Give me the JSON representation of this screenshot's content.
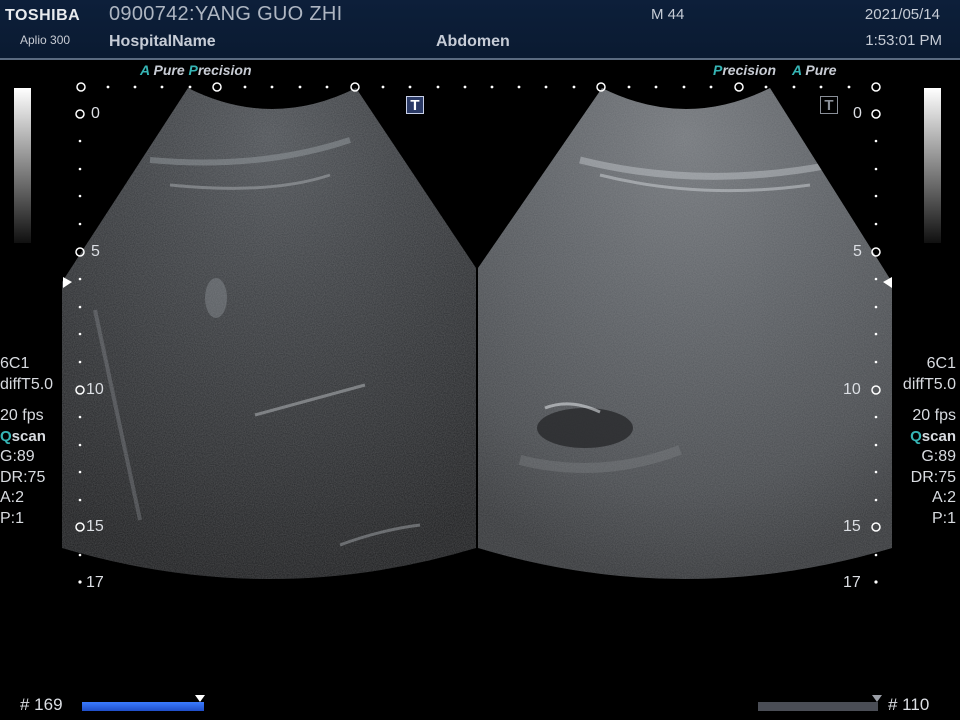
{
  "header": {
    "brand": "TOSHIBA",
    "model": "Aplio 300",
    "patient": "0900742:YANG GUO ZHI",
    "hospital": "HospitalName",
    "region": "Abdomen",
    "sex_age": "M 44",
    "date": "2021/05/14",
    "time": "1:53:01 PM"
  },
  "left_pane": {
    "mode_a": "A",
    "mode_pure": "Pure ",
    "mode_p": "P",
    "mode_precision": "recision",
    "t_label": "T",
    "t_state": "active",
    "depths": [
      "0",
      "5",
      "10",
      "15",
      "17"
    ],
    "params": {
      "probe": "6C1",
      "preset": "diffT5.0",
      "fps": "20 fps",
      "qscan_q": "Q",
      "qscan_rest": "scan",
      "gain": "G:89",
      "dr": "DR:75",
      "a": "A:2",
      "p": "P:1"
    },
    "frame": "# 169",
    "cine_fraction": 1.0
  },
  "right_pane": {
    "mode_p": "P",
    "mode_precision": "recision",
    "mode_a": "A",
    "mode_pure": "Pure",
    "t_label": "T",
    "t_state": "inactive",
    "depths": [
      "0",
      "5",
      "10",
      "15",
      "17"
    ],
    "params": {
      "probe": "6C1",
      "preset": "diffT5.0",
      "fps": "20 fps",
      "qscan_q": "Q",
      "qscan_rest": "scan",
      "gain": "G:89",
      "dr": "DR:75",
      "a": "A:2",
      "p": "P:1"
    },
    "frame": "# 110",
    "cine_fraction": 1.0
  },
  "colors": {
    "header_bg": "#0a1a31",
    "accent": "#36b5b5",
    "cine_active": "#3a7cff",
    "cine_inactive": "#4a4d55"
  }
}
